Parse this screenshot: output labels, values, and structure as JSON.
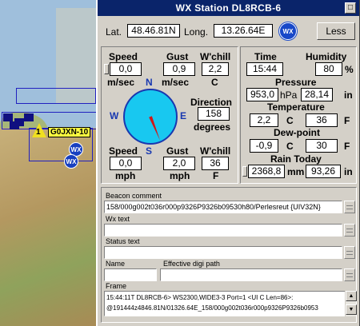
{
  "map": {
    "station_label": "G0JXN-10",
    "triangle_number": "1",
    "wx_text": "WX"
  },
  "window": {
    "title": "WX Station  DL8RCB-6",
    "close_glyph": "□"
  },
  "position": {
    "lat_label": "Lat.",
    "lat_value": "48.46.81N",
    "long_label": "Long.",
    "long_value": "13.26.64E",
    "wx_badge": "WX",
    "less_button": "Less"
  },
  "wind_metric": {
    "speed_label": "Speed",
    "speed_value": "0,0",
    "speed_unit": "m/sec",
    "gust_label": "Gust",
    "gust_value": "0,9",
    "gust_unit": "m/sec",
    "chill_label": "W'chill",
    "chill_value": "2,2",
    "chill_unit": "C"
  },
  "compass": {
    "n": "N",
    "s": "S",
    "e": "E",
    "w": "W",
    "direction_label": "Direction",
    "direction_value": "158",
    "direction_unit": "degrees",
    "direction_deg": 158
  },
  "wind_imperial": {
    "speed_label": "Speed",
    "speed_value": "0,0",
    "speed_unit": "mph",
    "gust_label": "Gust",
    "gust_value": "2,0",
    "gust_unit": "mph",
    "chill_label": "W'chill",
    "chill_value": "36",
    "chill_unit": "F"
  },
  "conditions": {
    "time_label": "Time",
    "time_value": "15:44",
    "humidity_label": "Humidity",
    "humidity_value": "80",
    "humidity_unit": "%",
    "pressure_label": "Pressure",
    "pressure_hpa": "953,0",
    "pressure_hpa_unit": "hPa",
    "pressure_in": "28,14",
    "pressure_in_unit": "in",
    "temp_label": "Temperature",
    "temp_c": "2,2",
    "temp_c_unit": "C",
    "temp_f": "36",
    "temp_f_unit": "F",
    "dew_label": "Dew-point",
    "dew_c": "-0,9",
    "dew_c_unit": "C",
    "dew_f": "30",
    "dew_f_unit": "F",
    "rain_label": "Rain Today",
    "rain_mm": "2368,8",
    "rain_mm_unit": "mm",
    "rain_in": "93,26",
    "rain_in_unit": "in"
  },
  "fields": {
    "beacon_label": "Beacon comment",
    "beacon_value": "158/000g002t036r000p9326P9326b09530h80/Perlesreut {UIV32N}",
    "wx_text_label": "Wx text",
    "wx_text_value": "",
    "status_label": "Status text",
    "status_value": "",
    "name_label": "Name",
    "name_value": "",
    "digi_label": "Effective digi path",
    "digi_value": "",
    "frame_label": "Frame",
    "frame_line1": "15:44:11T DL8RCB-6> WS2300,WIDE3-3 Port=1 <UI C Len=86>:",
    "frame_line2": "@191444z4846.81N/01326.64E_158/000g002t036r000p9326P9326b0953"
  },
  "colors": {
    "title_bar": "#0a246a",
    "window_bg": "#d4d0c8",
    "compass_fill": "#18c8f0",
    "compass_ring": "#1838b0",
    "needle": "#d01818"
  }
}
